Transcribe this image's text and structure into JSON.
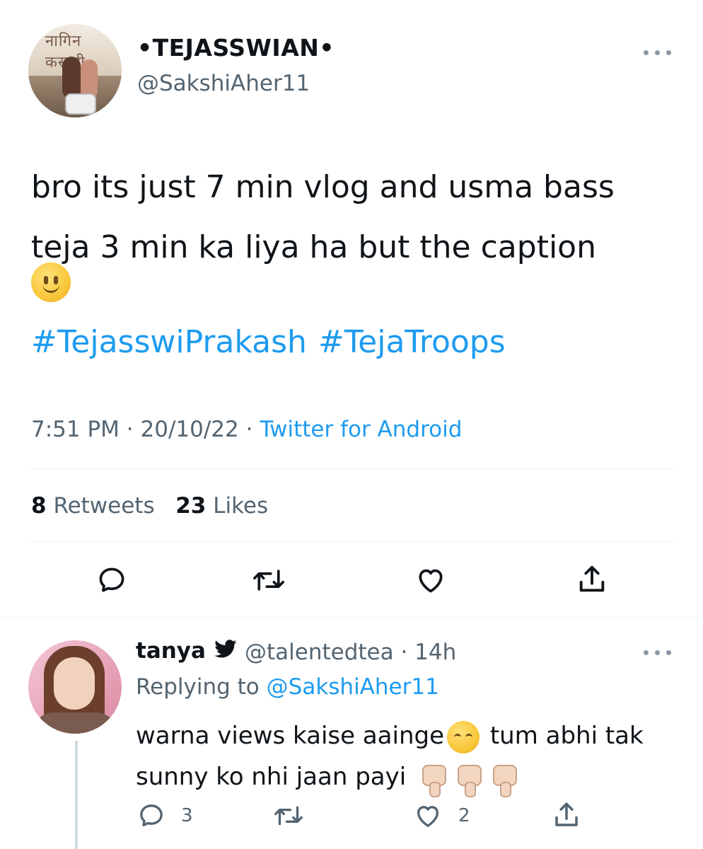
{
  "tweet": {
    "display_name": "•TEJASSWIAN•",
    "handle": "@SakshiAher11",
    "avatar_logo_text": "नागिन कस्तूरी",
    "text_line1": "bro its just 7 min vlog and usma bass",
    "text_line2": "teja 3 min ka liya ha but the caption",
    "emoji": "slightly-smiling-face",
    "hashtags": [
      "#TejasswiPrakash",
      "#TejaTroops"
    ],
    "time": "7:51 PM",
    "date": "20/10/22",
    "source": "Twitter for Android",
    "retweets_count": "8",
    "retweets_label": "Retweets",
    "likes_count": "23",
    "likes_label": "Likes",
    "actions": [
      "reply-icon",
      "retweet-icon",
      "like-icon",
      "share-icon"
    ]
  },
  "reply": {
    "display_name": "tanya",
    "verified_icon": "twitter-bird-icon",
    "handle_time": "@talentedtea · 14h",
    "replying_prefix": "Replying to",
    "replying_handle": "@SakshiAher11",
    "text_part1": "warna views kaise aainge",
    "text_part2": " tum abhi tak",
    "text_part3": "sunny ko nhi jaan payi",
    "emojis": [
      "pensive-face",
      "thumbs-down",
      "thumbs-down",
      "thumbs-down"
    ],
    "reply_count": "3",
    "like_count": "2"
  },
  "colors": {
    "link": "#1d9bf0",
    "secondary_text": "#536471",
    "primary_text": "#0f1419",
    "divider": "#eff3f4"
  }
}
